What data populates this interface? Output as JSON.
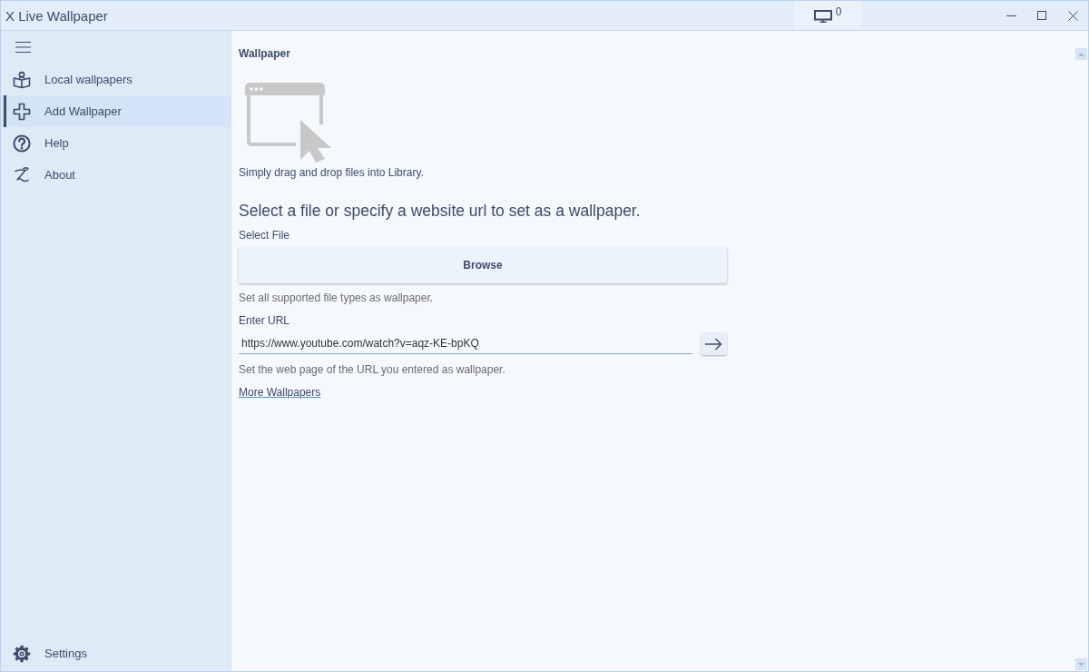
{
  "window": {
    "title": "X Live Wallpaper",
    "monitor_count": "0"
  },
  "sidebar": {
    "items": [
      {
        "label": "Local wallpapers",
        "selected": false
      },
      {
        "label": "Add Wallpaper",
        "selected": true
      },
      {
        "label": "Help",
        "selected": false
      },
      {
        "label": "About",
        "selected": false
      }
    ],
    "footer": {
      "label": "Settings"
    }
  },
  "content": {
    "section_title": "Wallpaper",
    "drop_hint": "Simply drag and drop files into Library.",
    "heading": "Select a file or specify a website url to set as a wallpaper.",
    "file": {
      "label": "Select File",
      "button": "Browse",
      "hint": "Set all supported file types as wallpaper."
    },
    "url": {
      "label": "Enter URL",
      "value": "https://www.youtube.com/watch?v=aqz-KE-bpKQ",
      "hint": "Set the web page of the URL you entered as wallpaper."
    },
    "link": "More Wallpapers"
  }
}
